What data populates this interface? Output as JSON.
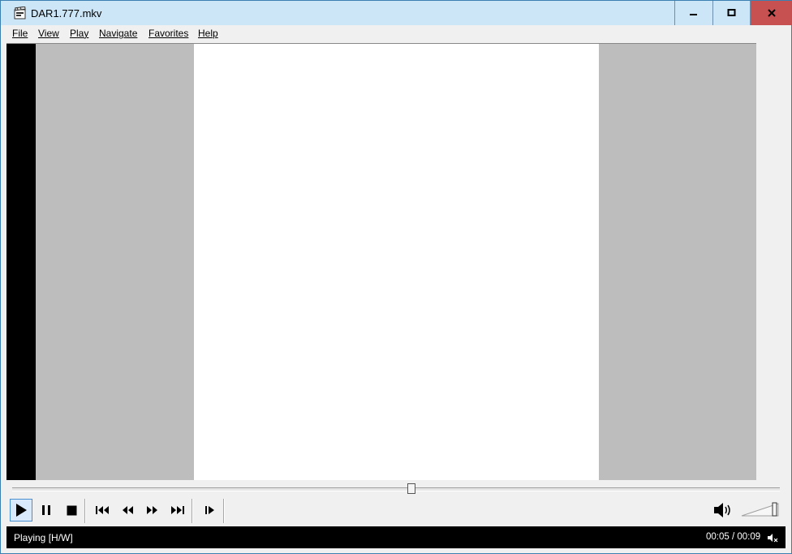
{
  "window": {
    "title": "DAR1.777.mkv",
    "minimize_icon": "minimize-icon",
    "maximize_icon": "maximize-icon",
    "close_icon": "close-icon"
  },
  "menu": {
    "file": "File",
    "view": "View",
    "play": "Play",
    "navigate": "Navigate",
    "favorites": "Favorites",
    "help": "Help"
  },
  "playback": {
    "position_fraction": 0.52
  },
  "toolbar": {
    "buttons": [
      "play-icon",
      "pause-icon",
      "stop-icon",
      "skip-back-icon",
      "rewind-icon",
      "fast-forward-icon",
      "skip-forward-icon",
      "frame-step-icon"
    ],
    "volume_icon": "speaker-icon",
    "volume_level": 0.9
  },
  "status": {
    "text": "Playing [H/W]",
    "time": "00:05 / 00:09"
  },
  "colors": {
    "titlebar": "#cde6f7",
    "close_button": "#c75050",
    "pillarbox": "#bdbdbd",
    "frame": "#ffffff",
    "status_bg": "#000000"
  }
}
